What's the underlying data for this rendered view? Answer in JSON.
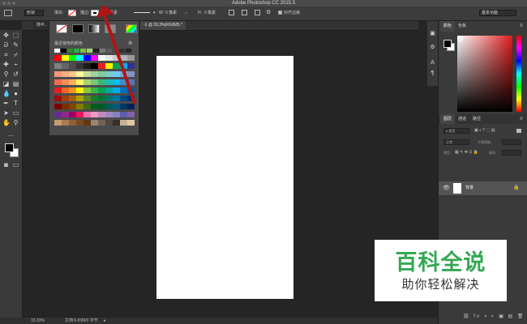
{
  "app": {
    "title": "Adobe Photoshop CC 2015.5"
  },
  "options": {
    "mode": "形状",
    "fill_label": "填充:",
    "stroke_label": "描边:",
    "stroke_size": "20 像素",
    "w_label": "W:",
    "w_value": "0 像素",
    "h_label": "H:",
    "h_value": "0 像素",
    "align_label": "对齐边缘",
    "workspace": "基本功能"
  },
  "tabs": {
    "doc1": "随平..",
    "doc2": "-1 @ 33.3%(RGB/8) *"
  },
  "popup": {
    "recent_label": "最近使用的颜色",
    "recent_colors": [
      "#ffffff",
      "#000000",
      "#2b8d2b",
      "#35a853",
      "#7ac043",
      "#a3d36b",
      "#1e1e1e",
      "#777777",
      "#5b5b5b",
      "#4a4a4a",
      "#333333",
      "#262626"
    ],
    "swatches": [
      [
        "#ff0000",
        "#ffff00",
        "#00ff00",
        "#00ffff",
        "#0000ff",
        "#ff00ff",
        "#ffffff",
        "#e6e6e6",
        "#cccccc",
        "#b3b3b3",
        "#999999"
      ],
      [
        "#808080",
        "#666666",
        "#4d4d4d",
        "#333333",
        "#1a1a1a",
        "#000000",
        "#ed1c24",
        "#fff200",
        "#00a651",
        "#00aeef",
        "#2e3192"
      ],
      [
        "#f7977a",
        "#f9ad81",
        "#fdc68a",
        "#fff79a",
        "#c4df9b",
        "#a2d39c",
        "#82ca9d",
        "#7bcdc8",
        "#6ecff6",
        "#7ea7d8",
        "#8493ca"
      ],
      [
        "#f26c4f",
        "#f68e55",
        "#fbaf5c",
        "#fff467",
        "#acd372",
        "#7cc576",
        "#3bb878",
        "#1abbb4",
        "#00bff3",
        "#438cca",
        "#5574b9"
      ],
      [
        "#ed1c24",
        "#f26522",
        "#f7941d",
        "#fff200",
        "#8dc73f",
        "#39b54a",
        "#00a651",
        "#00a99d",
        "#00aeef",
        "#0072bc",
        "#0054a6"
      ],
      [
        "#9e0b0f",
        "#a0410d",
        "#a3620a",
        "#aba000",
        "#598527",
        "#1a7b30",
        "#007236",
        "#00746b",
        "#0076a3",
        "#004a80",
        "#003471"
      ],
      [
        "#790000",
        "#7b2e00",
        "#7d4900",
        "#827b00",
        "#406618",
        "#005e20",
        "#005826",
        "#005952",
        "#005b7f",
        "#003663",
        "#002157"
      ],
      [
        "#662d91",
        "#92278f",
        "#9e005d",
        "#ed145b",
        "#f06eaa",
        "#f49ac1",
        "#bd8cbf",
        "#a187be",
        "#8882be",
        "#605ca8",
        "#8560a8"
      ],
      [
        "#c69c6d",
        "#a67c52",
        "#8c6239",
        "#754c24",
        "#603913",
        "#998675",
        "#736357",
        "#534741",
        "#362f2d",
        "#c7b299",
        "#e0c9a6"
      ]
    ]
  },
  "panels": {
    "color_tab": "颜色",
    "swatches_tab": "色板",
    "layers_tab": "图层",
    "channels_tab": "通道",
    "paths_tab": "路径",
    "kind_placeholder": "p 类型",
    "blend_mode": "正常",
    "opacity_label": "不透明度:",
    "lock_label": "锁定:",
    "fill_label": "填充:",
    "layer_name": "背景"
  },
  "status": {
    "zoom": "33.33%",
    "doc": "文档:6.83M/0 字节"
  },
  "watermark": {
    "line1": "百科全说",
    "line2": "助你轻松解决"
  }
}
